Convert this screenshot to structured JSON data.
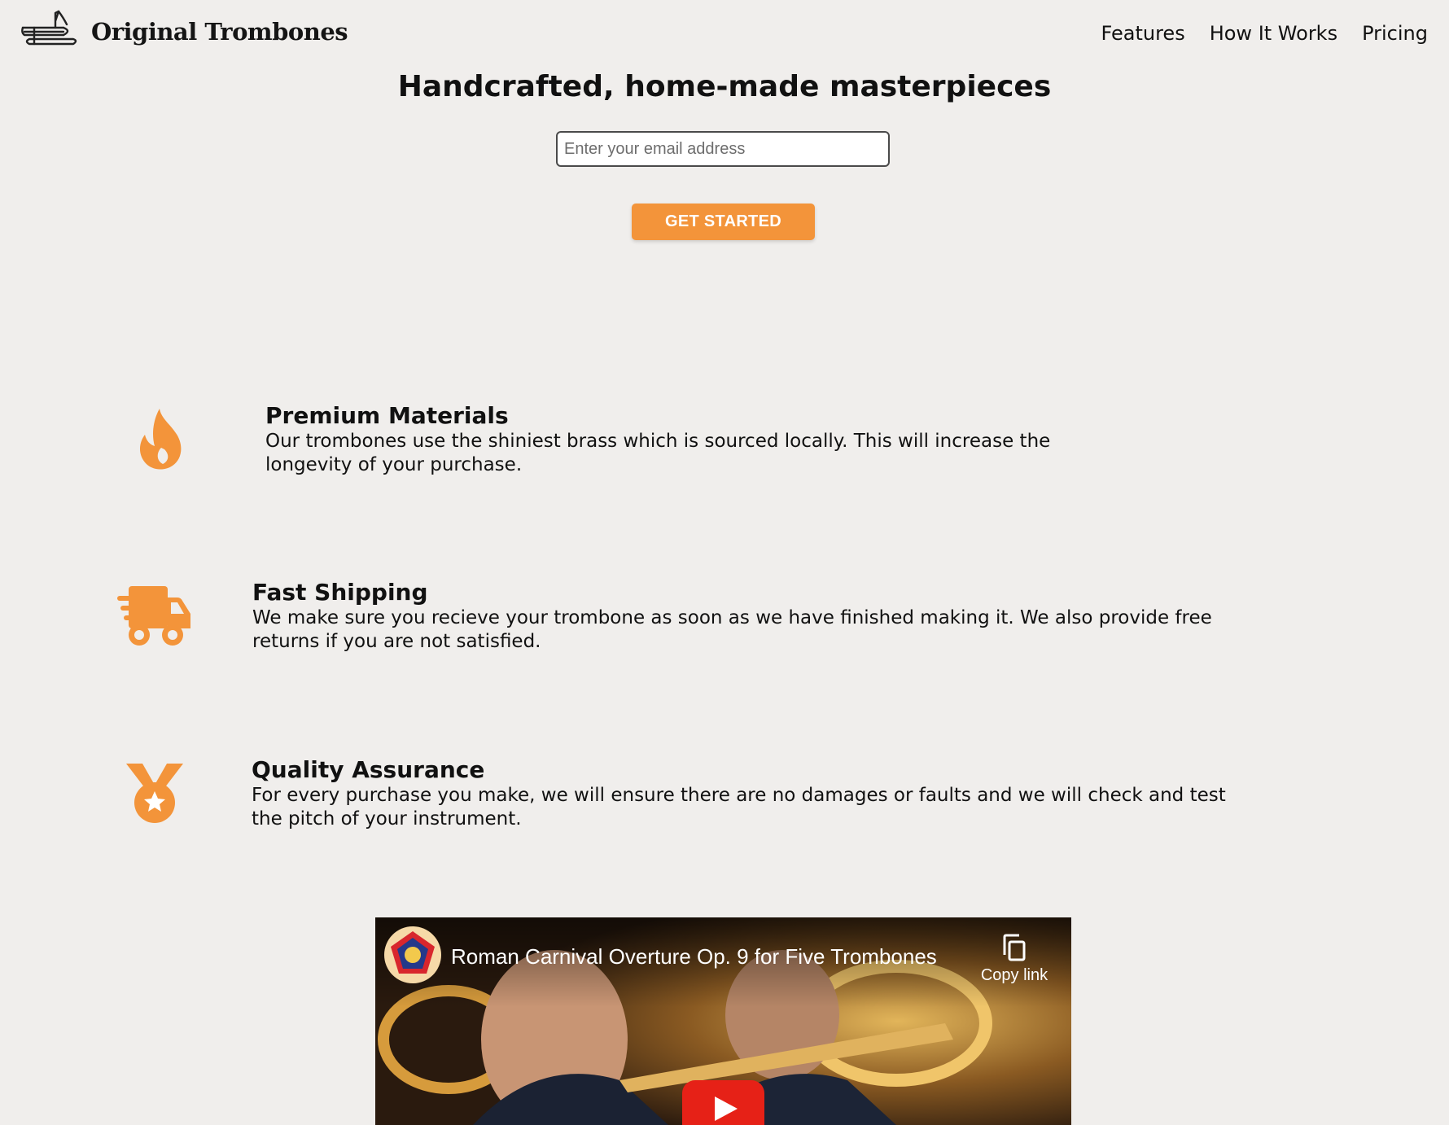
{
  "header": {
    "logo_icon": "trombone-icon",
    "brand": "Original Trombones",
    "nav": [
      {
        "label": "Features"
      },
      {
        "label": "How It Works"
      },
      {
        "label": "Pricing"
      }
    ]
  },
  "hero": {
    "title": "Handcrafted, home-made masterpieces",
    "email_placeholder": "Enter your email address",
    "cta_label": "GET STARTED"
  },
  "features": [
    {
      "icon": "fire-icon",
      "title": "Premium Materials",
      "description": "Our trombones use the shiniest brass which is sourced locally. This will increase the longevity of your purchase."
    },
    {
      "icon": "shipping-truck-icon",
      "title": "Fast Shipping",
      "description": "We make sure you recieve your trombone as soon as we have finished making it. We also provide free returns if you are not satisfied."
    },
    {
      "icon": "medal-icon",
      "title": "Quality Assurance",
      "description": "For every purchase you make, we will ensure there are no damages or faults and we will check and test the pitch of your instrument."
    }
  ],
  "video": {
    "title": "Roman Carnival Overture Op. 9 for Five Trombones",
    "copy_link_label": "Copy link",
    "play_icon": "play-icon"
  },
  "colors": {
    "accent": "#f3943a",
    "background": "#f0eeec",
    "youtube_red": "#e62117"
  }
}
